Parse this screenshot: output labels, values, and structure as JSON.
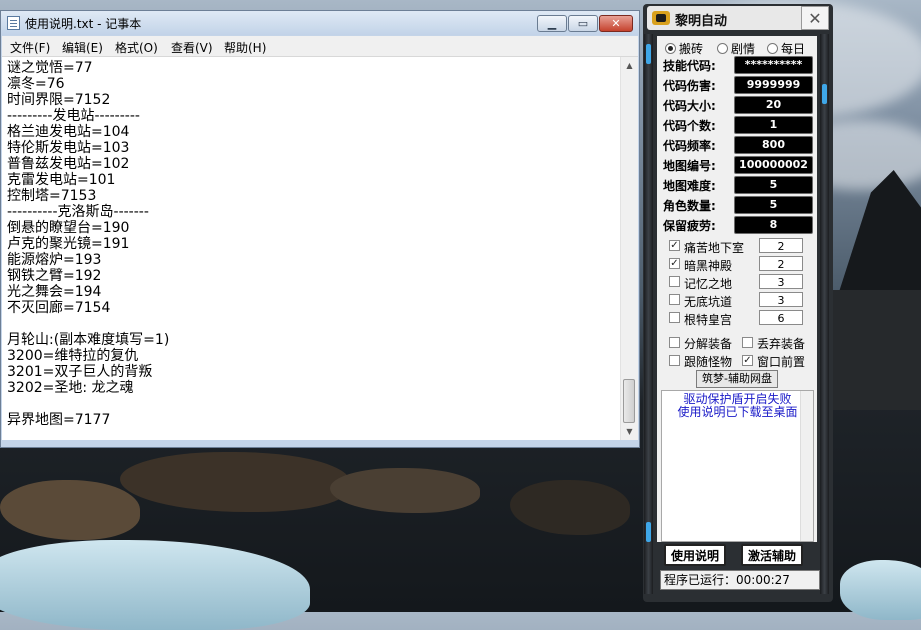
{
  "notepad": {
    "title": "使用说明.txt - 记事本",
    "menu": [
      "文件(F)",
      "编辑(E)",
      "格式(O)",
      "查看(V)",
      "帮助(H)"
    ],
    "lines": [
      "谜之觉悟=77",
      "凛冬=76",
      "时间界限=7152",
      "---------发电站---------",
      "格兰迪发电站=104",
      "特伦斯发电站=103",
      "普鲁兹发电站=102",
      "克雷发电站=101",
      "控制塔=7153",
      "----------克洛斯岛-------",
      "倒悬的瞭望台=190",
      "卢克的聚光镜=191",
      "能源熔炉=193",
      "钢铁之臂=192",
      "光之舞会=194",
      "不灭回廊=7154",
      "",
      "月轮山:(副本难度填写=1)",
      "3200=维特拉的复仇",
      "3201=双子巨人的背叛",
      "3202=圣地: 龙之魂",
      "",
      "异界地图=7177"
    ]
  },
  "tool": {
    "title": "黎明自动",
    "radios": [
      {
        "label": "搬砖",
        "checked": true
      },
      {
        "label": "剧情",
        "checked": false
      },
      {
        "label": "每日",
        "checked": false
      }
    ],
    "fields": [
      {
        "label": "技能代码:",
        "value": "**********"
      },
      {
        "label": "代码伤害:",
        "value": "9999999"
      },
      {
        "label": "代码大小:",
        "value": "20"
      },
      {
        "label": "代码个数:",
        "value": "1"
      },
      {
        "label": "代码频率:",
        "value": "800"
      },
      {
        "label": "地图编号:",
        "value": "100000002"
      },
      {
        "label": "地图难度:",
        "value": "5"
      },
      {
        "label": "角色数量:",
        "value": "5"
      },
      {
        "label": "保留疲劳:",
        "value": "8"
      }
    ],
    "dungeons": [
      {
        "label": "痛苦地下室",
        "checked": true,
        "value": "2"
      },
      {
        "label": "暗黑神殿",
        "checked": true,
        "value": "2"
      },
      {
        "label": "记忆之地",
        "checked": false,
        "value": "3"
      },
      {
        "label": "无底坑道",
        "checked": false,
        "value": "3"
      },
      {
        "label": "根特皇宫",
        "checked": false,
        "value": "6"
      }
    ],
    "options": [
      {
        "label": "分解装备",
        "checked": false
      },
      {
        "label": "丢弃装备",
        "checked": false
      },
      {
        "label": "跟随怪物",
        "checked": false
      },
      {
        "label": "窗口前置",
        "checked": true
      }
    ],
    "net_button": "筑梦-辅助网盘",
    "messages": [
      "驱动保护盾开启失败",
      "使用说明已下载至桌面"
    ],
    "btn_help": "使用说明",
    "btn_activate": "激活辅助",
    "status": "程序已运行：00:00:27"
  }
}
